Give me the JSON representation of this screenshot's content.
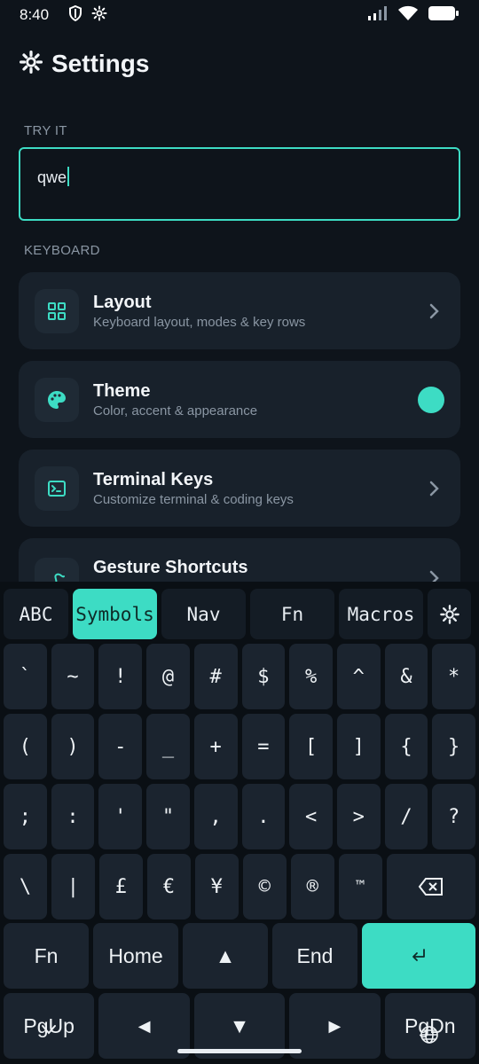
{
  "status_bar": {
    "time": "8:40"
  },
  "header": {
    "title": "Settings"
  },
  "sections": {
    "try_it": "TRY IT",
    "keyboard": "KEYBOARD"
  },
  "try_input": {
    "value": "qwe"
  },
  "cards": [
    {
      "title": "Layout",
      "subtitle": "Keyboard layout, modes & key rows",
      "icon": "grid-icon",
      "trailing": "chevron"
    },
    {
      "title": "Theme",
      "subtitle": "Color, accent & appearance",
      "icon": "palette-icon",
      "trailing": "accent-dot"
    },
    {
      "title": "Terminal Keys",
      "subtitle": "Customize terminal & coding keys",
      "icon": "terminal-icon",
      "trailing": "chevron"
    },
    {
      "title": "Gesture Shortcuts",
      "subtitle": "",
      "icon": "gesture-icon",
      "trailing": "chevron"
    }
  ],
  "colors": {
    "accent": "#3ddcc4",
    "background": "#0e141b",
    "card": "#18212b",
    "key": "#1b242f"
  },
  "keyboard": {
    "modes": [
      "ABC",
      "Symbols",
      "Nav",
      "Fn",
      "Macros"
    ],
    "active_mode": "Symbols",
    "rows": [
      [
        "`",
        "~",
        "!",
        "@",
        "#",
        "$",
        "%",
        "^",
        "&",
        "*"
      ],
      [
        "(",
        ")",
        "-",
        "_",
        "+",
        "=",
        "[",
        "]",
        "{",
        "}"
      ],
      [
        ";",
        ":",
        "'",
        "\"",
        ",",
        ".",
        "<",
        ">",
        "/",
        "?"
      ],
      [
        "\\",
        "|",
        "£",
        "€",
        "¥",
        "©",
        "®",
        "™"
      ]
    ],
    "row5": [
      "Fn",
      "Home",
      "▲",
      "End"
    ],
    "row6": [
      "PgUp",
      "◄",
      "▼",
      "►",
      "PgDn"
    ]
  }
}
